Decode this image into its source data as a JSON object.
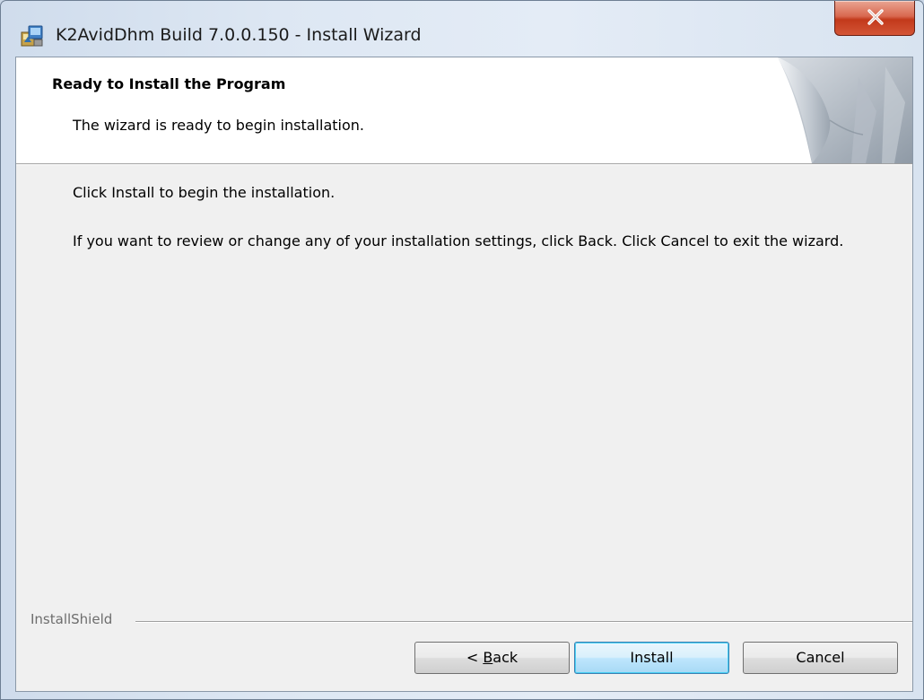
{
  "window": {
    "title": "K2AvidDhm Build 7.0.0.150 - Install Wizard",
    "close_label": "X"
  },
  "banner": {
    "heading": "Ready to Install the Program",
    "subheading": "The wizard is ready to begin installation."
  },
  "body": {
    "line1": "Click Install to begin the installation.",
    "line2": "If you want to review or change any of your installation settings, click Back. Click Cancel to exit the wizard."
  },
  "footer": {
    "brand": "InstallShield"
  },
  "buttons": {
    "back_prefix": "< ",
    "back_accel": "B",
    "back_rest": "ack",
    "install": "Install",
    "cancel": "Cancel"
  },
  "colors": {
    "close_button": "#c2391b",
    "default_button_border": "#3c7fb1",
    "dialog_background": "#f0f0f0"
  }
}
